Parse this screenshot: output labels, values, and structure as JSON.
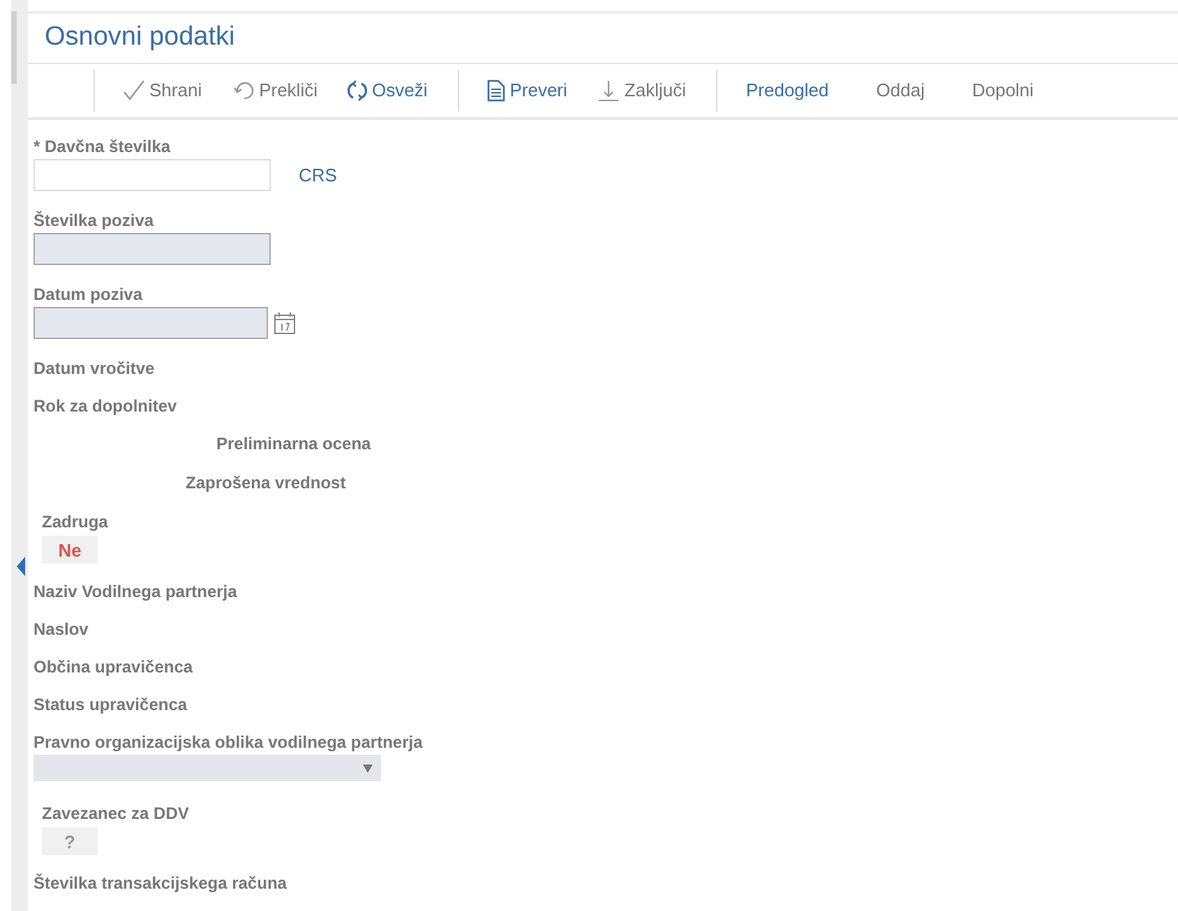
{
  "title": "Osnovni podatki",
  "toolbar": [
    [
      {
        "label": "Shrani",
        "kind": "check",
        "disabled": true
      },
      {
        "label": "Prekliči",
        "kind": "undo",
        "disabled": true
      },
      {
        "label": "Osveži",
        "kind": "refresh",
        "disabled": false
      }
    ],
    [
      {
        "label": "Preveri",
        "kind": "document",
        "disabled": false
      },
      {
        "label": "Zaključi",
        "kind": "download",
        "disabled": true
      }
    ],
    [
      {
        "label": "Predogled",
        "disabled": false
      },
      {
        "label": "Oddaj",
        "disabled": true
      },
      {
        "label": "Dopolni",
        "disabled": true
      }
    ]
  ],
  "fields": [
    {
      "kind": "text",
      "label": "* Davčna številka",
      "editable": true,
      "link": "CRS"
    },
    {
      "kind": "text",
      "label": "Številka poziva",
      "editable": false
    },
    {
      "kind": "date",
      "label": "Datum poziva",
      "editable": false
    },
    {
      "kind": "plain",
      "label": "Datum vročitve"
    },
    {
      "kind": "plain",
      "label": "Rok za dopolnitev"
    },
    {
      "kind": "centered",
      "label": "Preliminarna ocena"
    },
    {
      "kind": "centered",
      "label": "Zaprošena vrednost"
    },
    {
      "kind": "toggle",
      "label": "Zadruga",
      "value": "Ne",
      "color": "#d9534f"
    },
    {
      "kind": "plain",
      "label": "Naziv Vodilnega partnerja"
    },
    {
      "kind": "plain",
      "label": "Naslov"
    },
    {
      "kind": "plain",
      "label": "Občina upravičenca"
    },
    {
      "kind": "plain",
      "label": "Status upravičenca"
    },
    {
      "kind": "select",
      "label": "Pravno organizacijska oblika vodilnega partnerja"
    },
    {
      "kind": "toggle",
      "label": "Zavezanec za DDV",
      "value": "?",
      "color": "#999999"
    },
    {
      "kind": "plain",
      "label": "Številka transakcijskega računa"
    }
  ]
}
